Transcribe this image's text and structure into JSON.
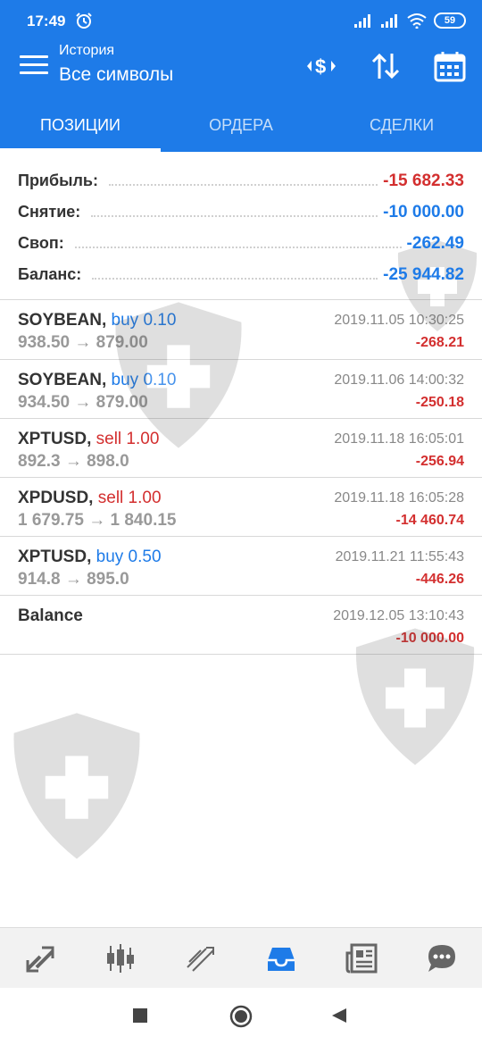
{
  "status_bar": {
    "time": "17:49",
    "battery": "59"
  },
  "header": {
    "subtitle": "История",
    "title": "Все символы"
  },
  "tabs": [
    {
      "label": "ПОЗИЦИИ",
      "active": true
    },
    {
      "label": "ОРДЕРА",
      "active": false
    },
    {
      "label": "СДЕЛКИ",
      "active": false
    }
  ],
  "summary": [
    {
      "label": "Прибыль:",
      "value": "-15 682.33",
      "color": "#d32f2f"
    },
    {
      "label": "Снятие:",
      "value": "-10 000.00",
      "color": "#1e7be8"
    },
    {
      "label": "Своп:",
      "value": "-262.49",
      "color": "#1e7be8"
    },
    {
      "label": "Баланс:",
      "value": "-25 944.82",
      "color": "#1e7be8"
    }
  ],
  "trades": [
    {
      "symbol": "SOYBEAN,",
      "side": "buy 0.10",
      "side_type": "buy",
      "prices": "938.50 → 879.00",
      "date": "2019.11.05 10:30:25",
      "profit": "-268.21"
    },
    {
      "symbol": "SOYBEAN,",
      "side": "buy 0.10",
      "side_type": "buy",
      "prices": "934.50 → 879.00",
      "date": "2019.11.06 14:00:32",
      "profit": "-250.18"
    },
    {
      "symbol": "XPTUSD,",
      "side": "sell 1.00",
      "side_type": "sell",
      "prices": "892.3 → 898.0",
      "date": "2019.11.18 16:05:01",
      "profit": "-256.94"
    },
    {
      "symbol": "XPDUSD,",
      "side": "sell 1.00",
      "side_type": "sell",
      "prices": "1 679.75 → 1 840.15",
      "date": "2019.11.18 16:05:28",
      "profit": "-14 460.74"
    },
    {
      "symbol": "XPTUSD,",
      "side": "buy 0.50",
      "side_type": "buy",
      "prices": "914.8 → 895.0",
      "date": "2019.11.21 11:55:43",
      "profit": "-446.26"
    },
    {
      "symbol": "Balance",
      "side": "",
      "side_type": "none",
      "prices": "",
      "date": "2019.12.05 13:10:43",
      "profit": "-10 000.00"
    }
  ],
  "bottom_nav": [
    {
      "icon": "quotes-icon",
      "active": false
    },
    {
      "icon": "chart-icon",
      "active": false
    },
    {
      "icon": "trade-icon",
      "active": false
    },
    {
      "icon": "history-icon",
      "active": true
    },
    {
      "icon": "news-icon",
      "active": false
    },
    {
      "icon": "chat-icon",
      "active": false
    }
  ],
  "colors": {
    "accent": "#1e7be8",
    "loss": "#d32f2f"
  }
}
